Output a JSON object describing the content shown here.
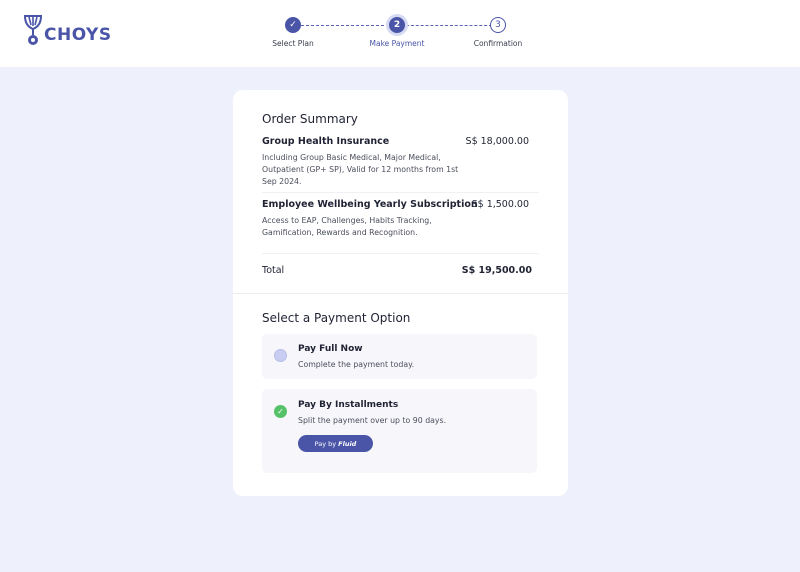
{
  "brand": {
    "name": "CHOYS",
    "color": "#4a55a8"
  },
  "stepper": {
    "steps": [
      {
        "label": "Select Plan",
        "marker": "✓",
        "state": "done"
      },
      {
        "label": "Make Payment",
        "marker": "2",
        "state": "active"
      },
      {
        "label": "Confirmation",
        "marker": "3",
        "state": "todo"
      }
    ]
  },
  "order_summary": {
    "title": "Order Summary",
    "items": [
      {
        "name": "Group Health Insurance",
        "description": "Including Group Basic Medical, Major Medical, Outpatient (GP+ SP), Valid for 12 months from 1st Sep 2024.",
        "price": "S$ 18,000.00"
      },
      {
        "name": "Employee Wellbeing Yearly Subscription",
        "description": "Access to EAP, Challenges, Habits Tracking, Gamification, Rewards and Recognition.",
        "price": "S$ 1,500.00"
      }
    ],
    "total_label": "Total",
    "total_value": "S$ 19,500.00"
  },
  "payment": {
    "title": "Select a Payment Option",
    "options": [
      {
        "title": "Pay Full Now",
        "description": "Complete the payment today.",
        "selected": false
      },
      {
        "title": "Pay By Installments",
        "description": "Split the payment over up to 90 days.",
        "selected": true
      }
    ],
    "pay_button": {
      "prefix": "Pay by",
      "brand": "Fluid"
    }
  },
  "colors": {
    "accent": "#4a55a8",
    "success": "#55c26a",
    "background": "#eef0fb"
  }
}
